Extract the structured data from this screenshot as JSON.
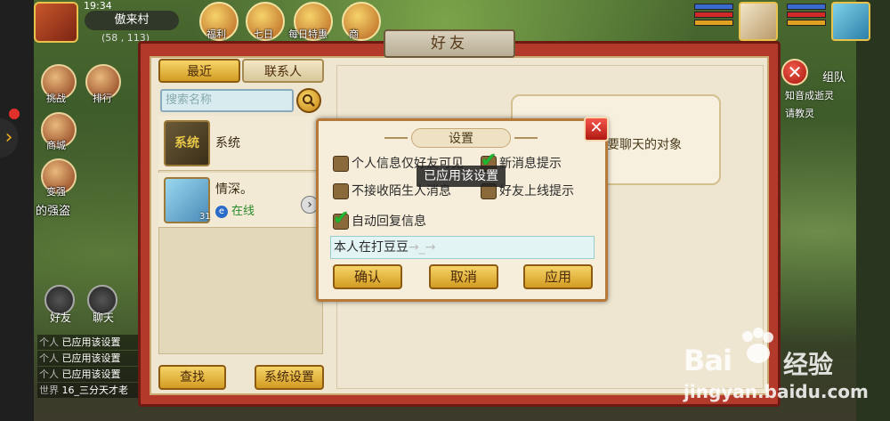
{
  "hud": {
    "time": "19:34",
    "location": "傲来村",
    "coords": "(58 , 113)",
    "top_icons": [
      {
        "label": "福利",
        "icon": "gift-icon"
      },
      {
        "label": "七日",
        "icon": "seven-day-icon"
      },
      {
        "label": "每日特惠",
        "icon": "daily-deal-icon"
      },
      {
        "label": "商",
        "icon": "shop-icon"
      }
    ],
    "side_buttons": [
      "挑战",
      "排行",
      "商城",
      "变强",
      "的强盗"
    ],
    "bottom_buttons": [
      "好友",
      "聊天"
    ]
  },
  "chat_log": [
    {
      "tag": "个人",
      "text": "已应用该设置"
    },
    {
      "tag": "个人",
      "text": "已应用该设置"
    },
    {
      "tag": "个人",
      "text": "已应用该设置"
    },
    {
      "tag": "世界",
      "text": "16_三分天才老"
    }
  ],
  "right_panel": {
    "team_label": "组队",
    "messages": [
      "知音成逝灵",
      "请教灵"
    ]
  },
  "friends_window": {
    "title": "好友",
    "tabs": [
      "最近",
      "联系人"
    ],
    "search_placeholder": "搜索名称",
    "contacts": [
      {
        "name": "系统",
        "avatar_text": "系统"
      },
      {
        "name": "情深。",
        "status": "在线",
        "level": "31"
      }
    ],
    "find_button": "查找",
    "system_settings_button": "系统设置",
    "chat_hint": "要聊天的对象"
  },
  "settings_dialog": {
    "title": "设置",
    "options": [
      {
        "label": "个人信息仅好友可见",
        "checked": false
      },
      {
        "label": "新消息提示",
        "checked": true
      },
      {
        "label": "不接收陌生人消息",
        "checked": false
      },
      {
        "label": "好友上线提示",
        "checked": false
      },
      {
        "label": "自动回复信息",
        "checked": true
      }
    ],
    "auto_reply_value": "本人在打豆豆",
    "auto_reply_suffix": "→_→",
    "buttons": {
      "confirm": "确认",
      "cancel": "取消",
      "apply": "应用"
    },
    "tooltip": "已应用该设置"
  },
  "watermark": {
    "brand_left": "Bai",
    "brand_right": "经验",
    "url": "jingyan.baidu.com"
  },
  "colors": {
    "window_red": "#b33a2a",
    "button_gold": "#d39b22",
    "check_green": "#1db830",
    "online_green": "#2a8a2a"
  }
}
